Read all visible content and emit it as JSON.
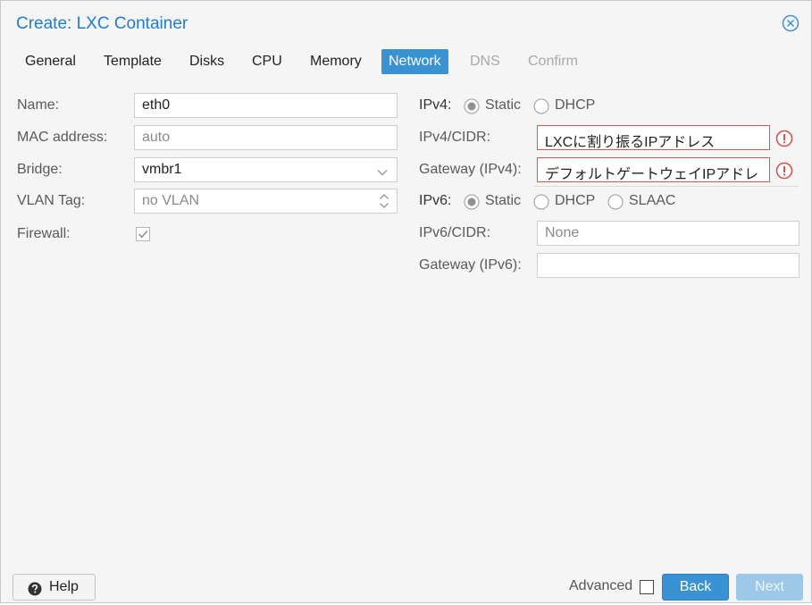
{
  "dialog": {
    "title": "Create: LXC Container"
  },
  "tabs": [
    {
      "label": "General",
      "state": "normal"
    },
    {
      "label": "Template",
      "state": "normal"
    },
    {
      "label": "Disks",
      "state": "normal"
    },
    {
      "label": "CPU",
      "state": "normal"
    },
    {
      "label": "Memory",
      "state": "normal"
    },
    {
      "label": "Network",
      "state": "active"
    },
    {
      "label": "DNS",
      "state": "disabled"
    },
    {
      "label": "Confirm",
      "state": "disabled"
    }
  ],
  "left": {
    "name": {
      "label": "Name:",
      "value": "eth0"
    },
    "mac": {
      "label": "MAC address:",
      "placeholder": "auto"
    },
    "bridge": {
      "label": "Bridge:",
      "value": "vmbr1"
    },
    "vlan": {
      "label": "VLAN Tag:",
      "placeholder": "no VLAN"
    },
    "firewall": {
      "label": "Firewall:",
      "checked": true
    }
  },
  "right": {
    "ipv4": {
      "label": "IPv4:",
      "options": [
        "Static",
        "DHCP"
      ],
      "selected": "Static",
      "cidr": {
        "label": "IPv4/CIDR:",
        "value": "LXCに割り振るIPアドレス",
        "invalid": true
      },
      "gateway": {
        "label": "Gateway (IPv4):",
        "value": "デフォルトゲートウェイIPアドレ",
        "invalid": true
      }
    },
    "ipv6": {
      "label": "IPv6:",
      "options": [
        "Static",
        "DHCP",
        "SLAAC"
      ],
      "selected": "Static",
      "cidr": {
        "label": "IPv6/CIDR:",
        "placeholder": "None"
      },
      "gateway": {
        "label": "Gateway (IPv6):",
        "value": ""
      }
    }
  },
  "footer": {
    "help_label": "Help",
    "advanced_label": "Advanced",
    "advanced_checked": false,
    "back_label": "Back",
    "next_label": "Next"
  },
  "colors": {
    "accent": "#3892d4",
    "title": "#1f7cd6",
    "error": "#d9534f",
    "disabled_button": "#9dc8e8"
  },
  "icons": {
    "close": "close-circle-icon",
    "error": "exclamation-circle-icon",
    "help": "question-circle-icon",
    "dropdown": "chevron-down-icon",
    "spinner": "spinner-arrows-icon",
    "check": "checkmark-icon"
  }
}
